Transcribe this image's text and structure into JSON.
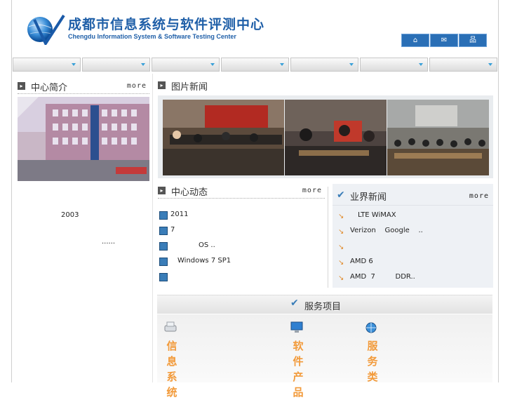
{
  "header": {
    "title_cn": "成都市信息系统与软件评测中心",
    "title_en": "Chengdu Information System & Software Testing Center",
    "tools": [
      {
        "name": "home-button",
        "icon": "home-icon",
        "glyph": "⌂"
      },
      {
        "name": "favorite-button",
        "icon": "bookmark-icon",
        "glyph": "✉"
      },
      {
        "name": "sitemap-button",
        "icon": "sitemap-icon",
        "glyph": "品"
      }
    ]
  },
  "nav": {
    "items": [
      "",
      "",
      "",
      "",
      "",
      "",
      ""
    ]
  },
  "intro": {
    "title": "中心简介",
    "more": "more",
    "text1": "2003",
    "text2": "......"
  },
  "photo_news": {
    "title": "图片新闻"
  },
  "center_news": {
    "title": "中心动态",
    "more": "more",
    "items": [
      "2011",
      "7",
      "OS ..",
      "Windows 7 SP1",
      ""
    ]
  },
  "industry_news": {
    "title": "业界新闻",
    "more": "more",
    "items": [
      "LTE WiMAX",
      "Verizon    Google    ..",
      "",
      "AMD 6",
      "AMD  7         DDR.."
    ]
  },
  "services": {
    "title": "服务项目",
    "cols": [
      {
        "text": "信息系统",
        "icon": "drive-icon"
      },
      {
        "text": "软件产品",
        "icon": "monitor-icon"
      },
      {
        "text": "服务类",
        "icon": "globe-icon"
      }
    ]
  },
  "colors": {
    "brand": "#1f5fa8",
    "accent": "#f29a3a"
  }
}
